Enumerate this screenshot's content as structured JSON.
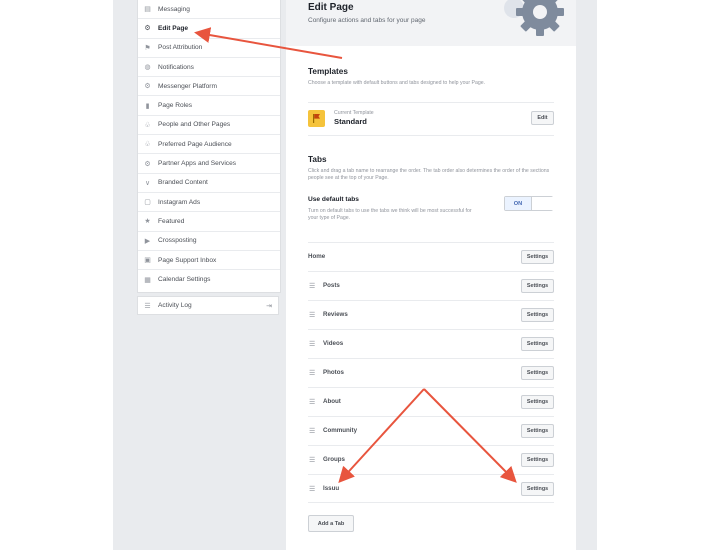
{
  "sidebar": {
    "items": [
      {
        "label": "Messaging",
        "icon": "message-icon"
      },
      {
        "label": "Edit Page",
        "icon": "gear-icon",
        "active": true
      },
      {
        "label": "Post Attribution",
        "icon": "flag-icon"
      },
      {
        "label": "Notifications",
        "icon": "globe-icon"
      },
      {
        "label": "Messenger Platform",
        "icon": "gear-icon"
      },
      {
        "label": "Page Roles",
        "icon": "people-icon"
      },
      {
        "label": "People and Other Pages",
        "icon": "thumbs-up-icon"
      },
      {
        "label": "Preferred Page Audience",
        "icon": "thumbs-up-icon"
      },
      {
        "label": "Partner Apps and Services",
        "icon": "gear-icon"
      },
      {
        "label": "Branded Content",
        "icon": "handshake-icon"
      },
      {
        "label": "Instagram Ads",
        "icon": "camera-icon"
      },
      {
        "label": "Featured",
        "icon": "star-icon"
      },
      {
        "label": "Crossposting",
        "icon": "video-icon"
      },
      {
        "label": "Page Support Inbox",
        "icon": "inbox-icon"
      },
      {
        "label": "Calendar Settings",
        "icon": "calendar-icon"
      }
    ],
    "activity_log": "Activity Log"
  },
  "header": {
    "title": "Edit Page",
    "subtitle": "Configure actions and tabs for your page"
  },
  "templates": {
    "title": "Templates",
    "desc": "Choose a template with default buttons and tabs designed to help your Page.",
    "current_label": "Current Template",
    "current_name": "Standard",
    "edit_label": "Edit"
  },
  "tabs": {
    "title": "Tabs",
    "desc": "Click and drag a tab name to rearrange the order. The tab order also determines the order of the sections people see at the top of your Page.",
    "use_default_title": "Use default tabs",
    "use_default_desc": "Turn on default tabs to use the tabs we think will be most successful for your type of Page.",
    "toggle_label": "ON",
    "items": [
      "Home",
      "Posts",
      "Reviews",
      "Videos",
      "Photos",
      "About",
      "Community",
      "Groups",
      "Issuu"
    ],
    "settings_label": "Settings",
    "add_tab_label": "Add a Tab"
  },
  "colors": {
    "accent": "#4267b2",
    "arrow": "#e8553e",
    "flag": "#f5c33b"
  }
}
